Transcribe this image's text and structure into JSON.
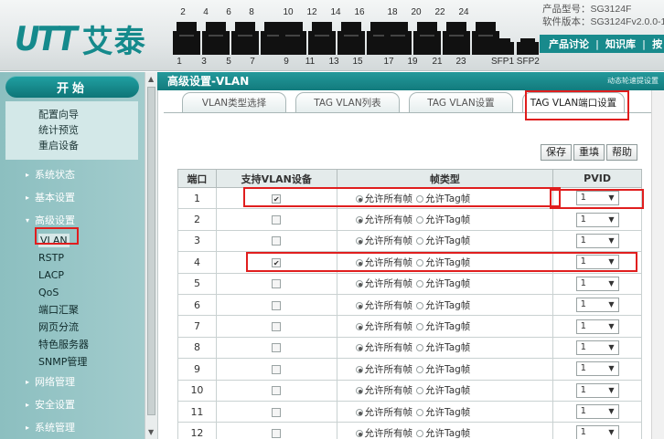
{
  "header": {
    "logo_text": "UTT",
    "logo_cn": "艾泰",
    "ports_top": [
      "2",
      "4",
      "6",
      "8",
      "10",
      "12",
      "14",
      "16",
      "18",
      "20",
      "22",
      "24"
    ],
    "ports_bottom": [
      "1",
      "3",
      "5",
      "7",
      "9",
      "11",
      "13",
      "15",
      "17",
      "19",
      "21",
      "23"
    ],
    "sfp_labels": "SFP1 SFP2",
    "product_model": "产品型号：SG3124F",
    "software_version": "软件版本：SG3124Fv2.0.0-1",
    "nav": [
      "产品讨论",
      "知识库",
      "按"
    ]
  },
  "sidebar": {
    "start": "开始",
    "quick_links": [
      "配置向导",
      "统计预览",
      "重启设备"
    ],
    "groups": [
      {
        "label": "系统状态",
        "expanded": false
      },
      {
        "label": "基本设置",
        "expanded": false
      },
      {
        "label": "高级设置",
        "expanded": true,
        "items": [
          "VLAN",
          "RSTP",
          "LACP",
          "QoS",
          "端口汇聚",
          "网页分流",
          "特色服务器",
          "SNMP管理"
        ]
      },
      {
        "label": "网络管理",
        "expanded": false
      },
      {
        "label": "安全设置",
        "expanded": false
      },
      {
        "label": "系统管理",
        "expanded": false
      }
    ],
    "active_item": "VLAN"
  },
  "content": {
    "title": "高级设置-VLAN",
    "help_link": "动态轮速提设置",
    "tabs": [
      "VLAN类型选择",
      "TAG VLAN列表",
      "TAG VLAN设置",
      "TAG VLAN端口设置"
    ],
    "active_tab": 3,
    "buttons": {
      "save": "保存",
      "reset": "重填",
      "help": "帮助"
    },
    "table": {
      "headers": [
        "端口",
        "支持VLAN设备",
        "帧类型",
        "PVID"
      ],
      "frame_options": [
        "允许所有帧",
        "允许Tag帧"
      ],
      "rows": [
        {
          "port": "1",
          "vlan_capable": true,
          "frame": 0,
          "pvid": "1"
        },
        {
          "port": "2",
          "vlan_capable": false,
          "frame": 0,
          "pvid": "1"
        },
        {
          "port": "3",
          "vlan_capable": false,
          "frame": 0,
          "pvid": "1"
        },
        {
          "port": "4",
          "vlan_capable": true,
          "frame": 0,
          "pvid": "1"
        },
        {
          "port": "5",
          "vlan_capable": false,
          "frame": 0,
          "pvid": "1"
        },
        {
          "port": "6",
          "vlan_capable": false,
          "frame": 0,
          "pvid": "1"
        },
        {
          "port": "7",
          "vlan_capable": false,
          "frame": 0,
          "pvid": "1"
        },
        {
          "port": "8",
          "vlan_capable": false,
          "frame": 0,
          "pvid": "1"
        },
        {
          "port": "9",
          "vlan_capable": false,
          "frame": 0,
          "pvid": "1"
        },
        {
          "port": "10",
          "vlan_capable": false,
          "frame": 0,
          "pvid": "1"
        },
        {
          "port": "11",
          "vlan_capable": false,
          "frame": 0,
          "pvid": "1"
        },
        {
          "port": "12",
          "vlan_capable": false,
          "frame": 0,
          "pvid": "1"
        }
      ]
    }
  }
}
